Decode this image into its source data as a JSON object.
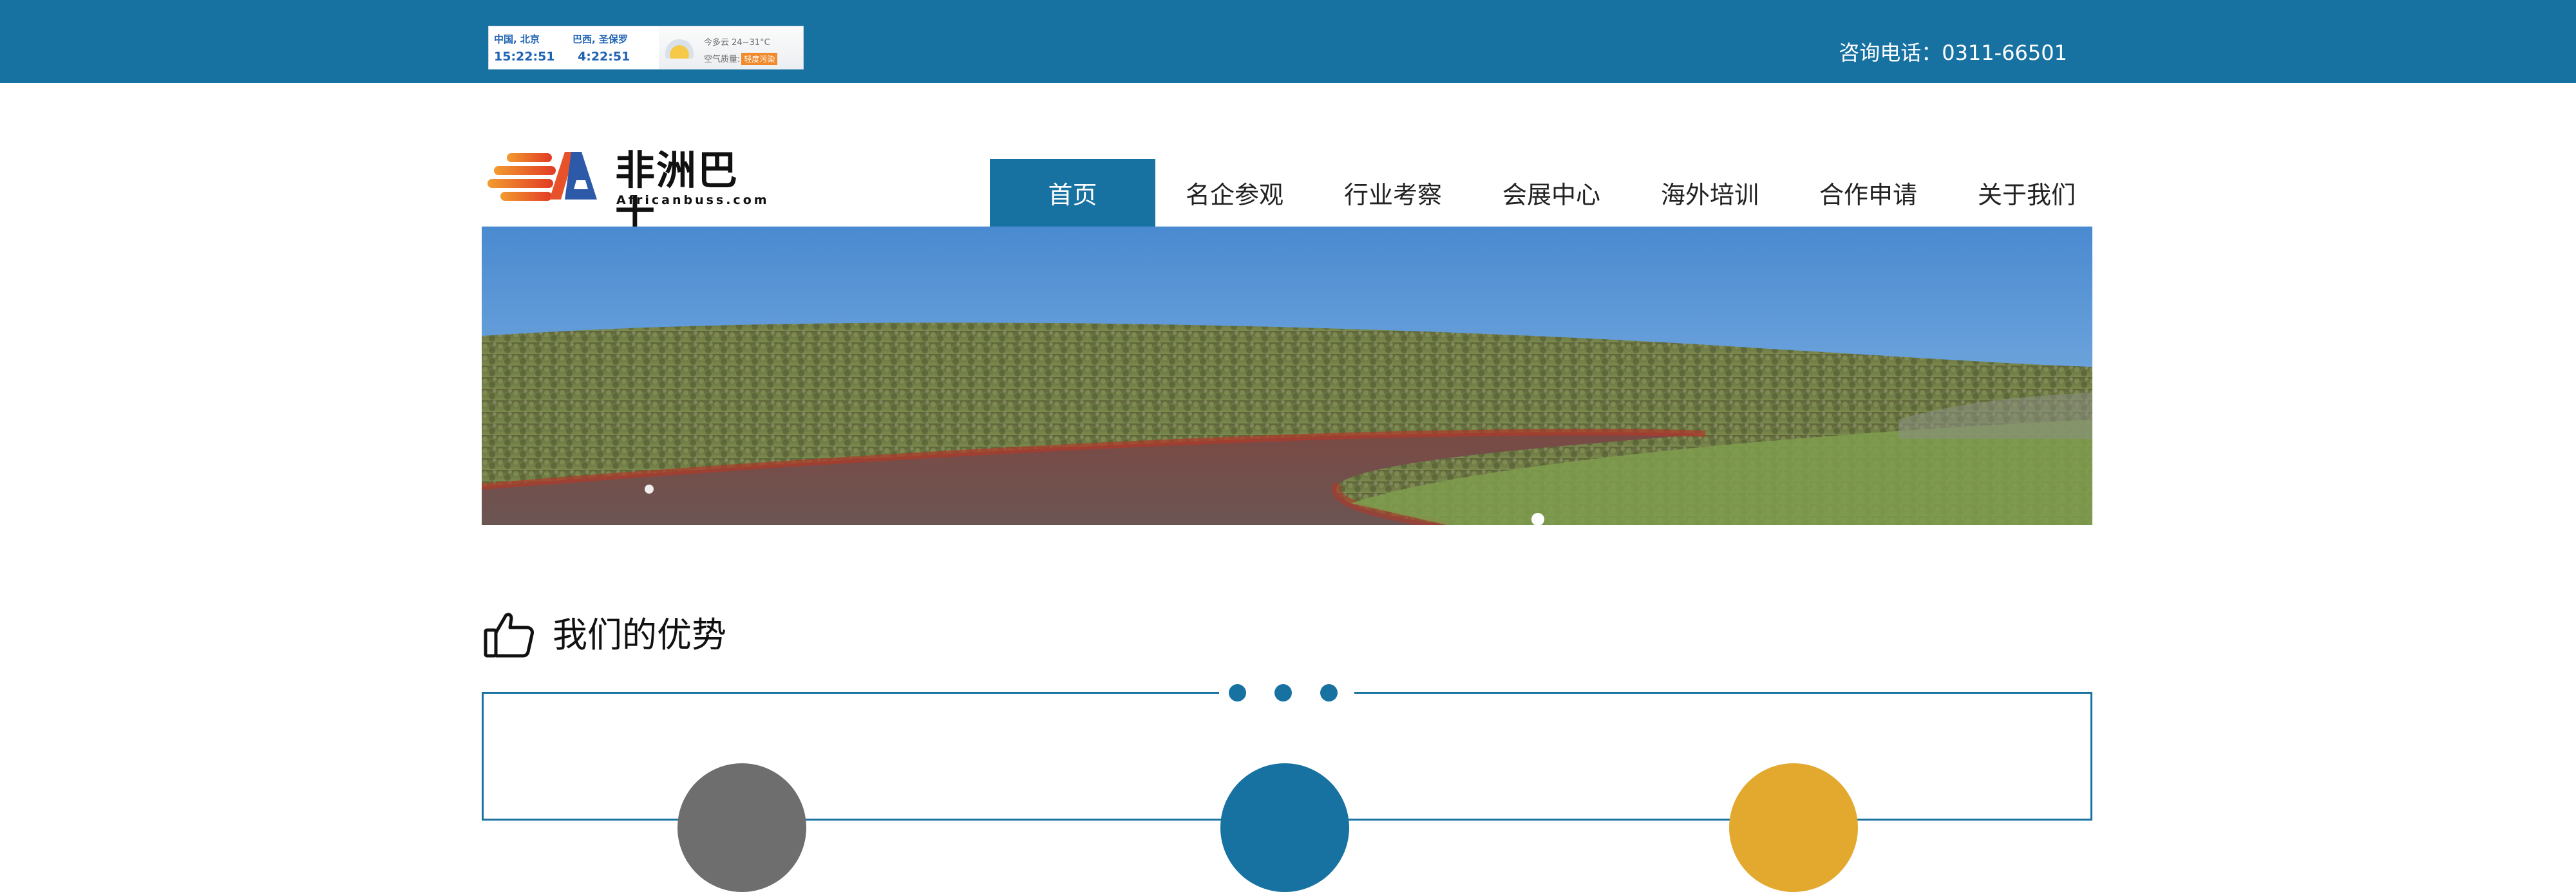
{
  "topbar": {
    "clock_a": {
      "city": "中国, 北京",
      "time": "15:22:51"
    },
    "clock_b": {
      "city": "巴西, 圣保罗",
      "time": "4:22:51"
    },
    "weather": {
      "line1": "今多云  24~31°C",
      "line2_prefix": "空气质量:",
      "air_badge": "轻度污染"
    },
    "hotline": "咨询电话：0311-66501"
  },
  "logo": {
    "name": "非洲巴士",
    "domain": "Africanbuss.com"
  },
  "nav": {
    "items": [
      {
        "label": "首页",
        "active": true
      },
      {
        "label": "名企参观"
      },
      {
        "label": "行业考察"
      },
      {
        "label": "会展中心"
      },
      {
        "label": "海外培训"
      },
      {
        "label": "合作申请"
      },
      {
        "label": "关于我们"
      }
    ]
  },
  "section": {
    "title": "我们的优势"
  },
  "colors": {
    "brand_blue": "#1772a2",
    "logo_orange": "#e8522a",
    "circle_gray": "#6e6e6e",
    "circle_blue": "#1772a2",
    "circle_gold": "#e2a92e"
  },
  "icons": {
    "thumb": "thumbs-up-icon"
  }
}
